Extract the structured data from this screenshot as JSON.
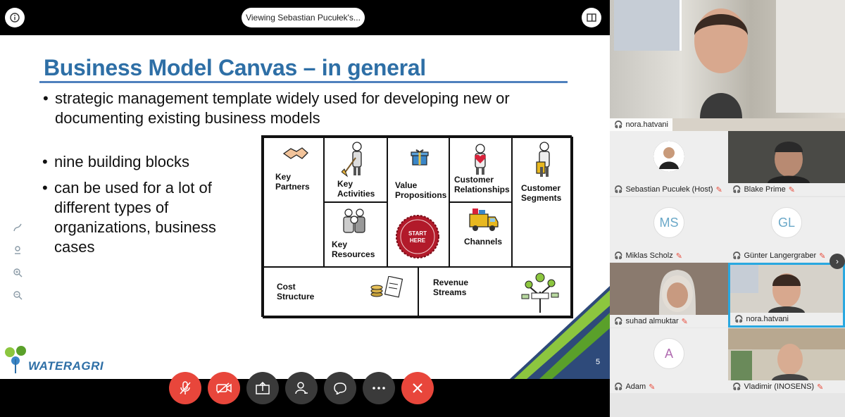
{
  "topbar": {
    "viewing_label": "Viewing Sebastian Pucułek's..."
  },
  "slide": {
    "title": "Business Model Canvas – in general",
    "bullets": [
      "strategic management template widely used for developing new or documenting existing business models",
      "nine building blocks",
      "can be used for a lot of different types of organizations, business cases"
    ],
    "bullet_lines": {
      "b1_l1": "strategic management template widely used for developing new or",
      "b1_l2": "documenting existing business models",
      "b2_l1": "nine building blocks",
      "b3_l1": "can be used for a lot of",
      "b3_l2": "different types of",
      "b3_l3": "organizations, business",
      "b3_l4": "cases"
    },
    "canvas": {
      "key_partners": "Key\nPartners",
      "key_activities": "Key\nActivities",
      "value_propositions": "Value\nPropositions",
      "customer_relationships": "Customer\nRelationships",
      "customer_segments": "Customer\nSegments",
      "key_resources": "Key\nResources",
      "channels": "Channels",
      "cost_structure": "Cost\nStructure",
      "revenue_streams": "Revenue\nStreams",
      "start_badge": "START\nHERE"
    },
    "logo_text": "WATERAGRI",
    "page_number": "5",
    "accent_colors": {
      "title": "#2e6fa6",
      "badge": "#b21a2a",
      "green": "#8cc63f"
    }
  },
  "controls": [
    "mic-muted",
    "video-off",
    "share",
    "participants",
    "chat",
    "more",
    "leave"
  ],
  "participants": {
    "speaker": {
      "name": "nora.hatvani"
    },
    "tiles": [
      {
        "name": "Sebastian Pucułek (Host)"
      },
      {
        "name": "Blake Prime"
      },
      {
        "name": "Miklas Scholz",
        "initials": "MS"
      },
      {
        "name": "Günter Langergraber",
        "initials": "GL"
      },
      {
        "name": "suhad almuktar"
      },
      {
        "name": "nora.hatvani"
      },
      {
        "name": "Adam",
        "initials": "A"
      },
      {
        "name": "Vladimir (INOSENS)"
      }
    ]
  }
}
